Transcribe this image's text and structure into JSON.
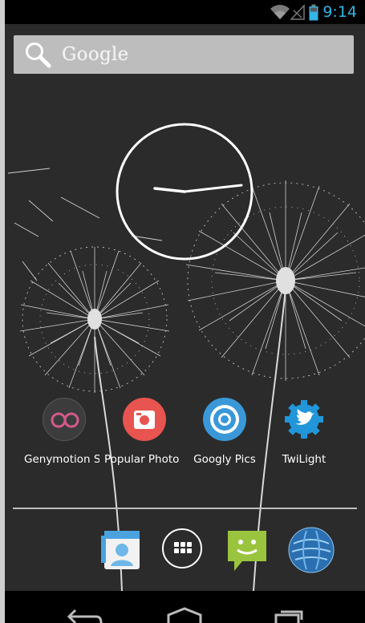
{
  "status_bar": {
    "time": "9:14",
    "icons": [
      "wifi-icon",
      "signal-icon",
      "battery-icon"
    ],
    "time_color": "#33b5e5"
  },
  "search": {
    "placeholder": "Google"
  },
  "apps": [
    {
      "name": "genymotion",
      "label": "Genymotion Shell"
    },
    {
      "name": "popular-photos",
      "label": "Popular Photos"
    },
    {
      "name": "googly-pics",
      "label": "Googly Pics"
    },
    {
      "name": "twilight",
      "label": "TwiLight"
    }
  ],
  "dock": [
    "contacts-icon",
    "all-apps-icon",
    "messaging-icon",
    "browser-icon"
  ],
  "navigation": [
    "back-icon",
    "home-icon",
    "recent-apps-icon"
  ],
  "colors": {
    "wallpaper": "#2b2b2b",
    "accent": "#33b5e5",
    "popular_photos": "#e8544f",
    "googly_pics": "#3a98d8",
    "twilight": "#2196d9",
    "messaging": "#9ac43e"
  }
}
